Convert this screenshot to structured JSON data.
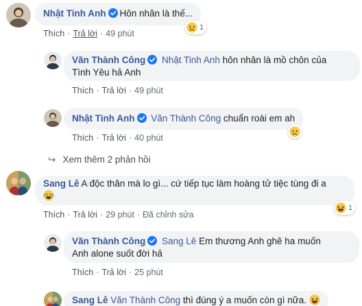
{
  "comments": [
    {
      "author": "Nhật Tinh Anh",
      "text": "Hôn nhân là thế...",
      "actions": {
        "like": "Thích",
        "reply": "Trả lời",
        "time": "49 phút"
      },
      "reaction": {
        "icon": "sad-reaction-icon",
        "count": "1"
      }
    },
    {
      "author": "Văn Thành Công",
      "tag": "Nhật Tinh Anh",
      "text_line1": "hôn nhân là mồ chôn của",
      "text_line2": "Tình Yêu hả Anh",
      "actions": {
        "like": "Thích",
        "reply": "Trả lời",
        "time": "49 phút"
      }
    },
    {
      "author": "Nhật Tinh Anh",
      "tag": "Văn Thành Công",
      "text": "chuẩn roài em ah",
      "actions": {
        "like": "Thích",
        "reply": "Trả lời",
        "time": "40 phút"
      },
      "reaction": {
        "icon": "sad-reaction-icon",
        "count": ""
      }
    },
    {
      "more_replies": "Xem thêm 2 phản hồi"
    },
    {
      "author": "Sang Lê",
      "text_line1": "A độc thân mà lo gì... cứ tiếp tục làm hoàng tử tiệc tùng đi a",
      "text_line2_emoji": "laughing-emoji-icon",
      "actions": {
        "like": "Thích",
        "reply": "Trả lời",
        "time": "29 phút",
        "edited": "Đã chỉnh sửa"
      },
      "reaction": {
        "icon": "haha-reaction-icon",
        "count": "1"
      }
    },
    {
      "author": "Văn Thành Công",
      "tag": "Sang Lê",
      "text_line1": "Em thương Anh ghê ha muốn",
      "text_line2": "Anh alone suốt đời hả",
      "actions": {
        "like": "Thích",
        "reply": "Trả lời",
        "time": "25 phút"
      }
    },
    {
      "author": "Sang Lê",
      "tag": "Văn Thành Công",
      "text": "thì đúng ý a muốn còn gì nữa.",
      "text_emoji": "haha-emoji-icon"
    }
  ],
  "colors": {
    "author": "#385898",
    "bubble": "#f2f3f5",
    "verified": "#1877f2",
    "meta": "#606770"
  }
}
